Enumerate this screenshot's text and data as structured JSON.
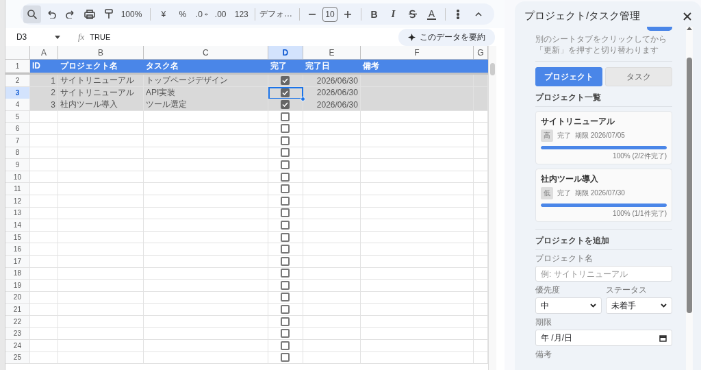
{
  "toolbar": {
    "search_active": true,
    "zoom": "100%",
    "currency": "¥",
    "percent": "%",
    "decrease_decimals": ".0",
    "increase_decimals": ".00",
    "number_format": "123",
    "font": "デフォ…",
    "font_size": "10",
    "bold": "B",
    "italic": "I",
    "text_color": "A"
  },
  "formula_bar": {
    "cell_ref": "D3",
    "fx": "fx",
    "formula": "TRUE",
    "summarize_button": "このデータを要約"
  },
  "columns": [
    {
      "letter": "A",
      "selected": false
    },
    {
      "letter": "B",
      "selected": false
    },
    {
      "letter": "C",
      "selected": false
    },
    {
      "letter": "D",
      "selected": true
    },
    {
      "letter": "E",
      "selected": false
    },
    {
      "letter": "F",
      "selected": false
    },
    {
      "letter": "G",
      "selected": false
    }
  ],
  "header_row": {
    "number": "1",
    "cells": [
      "ID",
      "プロジェクト名",
      "タスク名",
      "完了",
      "完了日",
      "備考"
    ]
  },
  "rows": [
    {
      "number": "2",
      "id": "1",
      "project": "サイトリニューアル",
      "task": "トップページデザイン",
      "done": true,
      "date": "2026/06/30",
      "selected": false
    },
    {
      "number": "3",
      "id": "2",
      "project": "サイトリニューアル",
      "task": "API実装",
      "done": true,
      "date": "2026/06/30",
      "selected": true
    },
    {
      "number": "4",
      "id": "3",
      "project": "社内ツール導入",
      "task": "ツール選定",
      "done": true,
      "date": "2026/06/30",
      "selected": false
    },
    {
      "number": "5",
      "done": false,
      "selected": false
    },
    {
      "number": "6",
      "done": false,
      "selected": false
    },
    {
      "number": "7",
      "done": false,
      "selected": false
    },
    {
      "number": "8",
      "done": false,
      "selected": false
    },
    {
      "number": "9",
      "done": false,
      "selected": false
    },
    {
      "number": "10",
      "done": false,
      "selected": false
    },
    {
      "number": "11",
      "done": false,
      "selected": false
    },
    {
      "number": "12",
      "done": false,
      "selected": false
    },
    {
      "number": "13",
      "done": false,
      "selected": false
    },
    {
      "number": "14",
      "done": false,
      "selected": false
    },
    {
      "number": "15",
      "done": false,
      "selected": false
    },
    {
      "number": "16",
      "done": false,
      "selected": false
    },
    {
      "number": "17",
      "done": false,
      "selected": false
    },
    {
      "number": "18",
      "done": false,
      "selected": false
    },
    {
      "number": "19",
      "done": false,
      "selected": false
    },
    {
      "number": "20",
      "done": false,
      "selected": false
    },
    {
      "number": "21",
      "done": false,
      "selected": false
    },
    {
      "number": "22",
      "done": false,
      "selected": false
    },
    {
      "number": "23",
      "done": false,
      "selected": false
    },
    {
      "number": "24",
      "done": false,
      "selected": false
    },
    {
      "number": "25",
      "done": false,
      "selected": false
    }
  ],
  "panel": {
    "title": "プロジェクト/タスク管理",
    "hint": "別のシートタブをクリックしてから「更新」を押すと切り替わります",
    "tabs": [
      {
        "label": "プロジェクト",
        "selected": true
      },
      {
        "label": "タスク",
        "selected": false
      }
    ],
    "list_heading": "プロジェクト一覧",
    "projects": [
      {
        "name": "サイトリニューアル",
        "priority": "高",
        "status": "完了",
        "deadline": "期限 2026/07/05",
        "level": 1,
        "progress": "100% (2/2件完了)"
      },
      {
        "name": "社内ツール導入",
        "priority": "低",
        "status": "完了",
        "deadline": "期限 2026/07/30",
        "level": 1,
        "progress": "100% (1/1件完了)"
      }
    ],
    "form": {
      "heading": "プロジェクトを追加",
      "name_label": "プロジェクト名",
      "name_placeholder": "例: サイトリニューアル",
      "priority_label": "優先度",
      "priority_value": "中",
      "status_label": "ステータス",
      "status_value": "未着手",
      "deadline_label": "期限",
      "deadline_value": "年 /月/日",
      "notes_label": "備考"
    }
  }
}
